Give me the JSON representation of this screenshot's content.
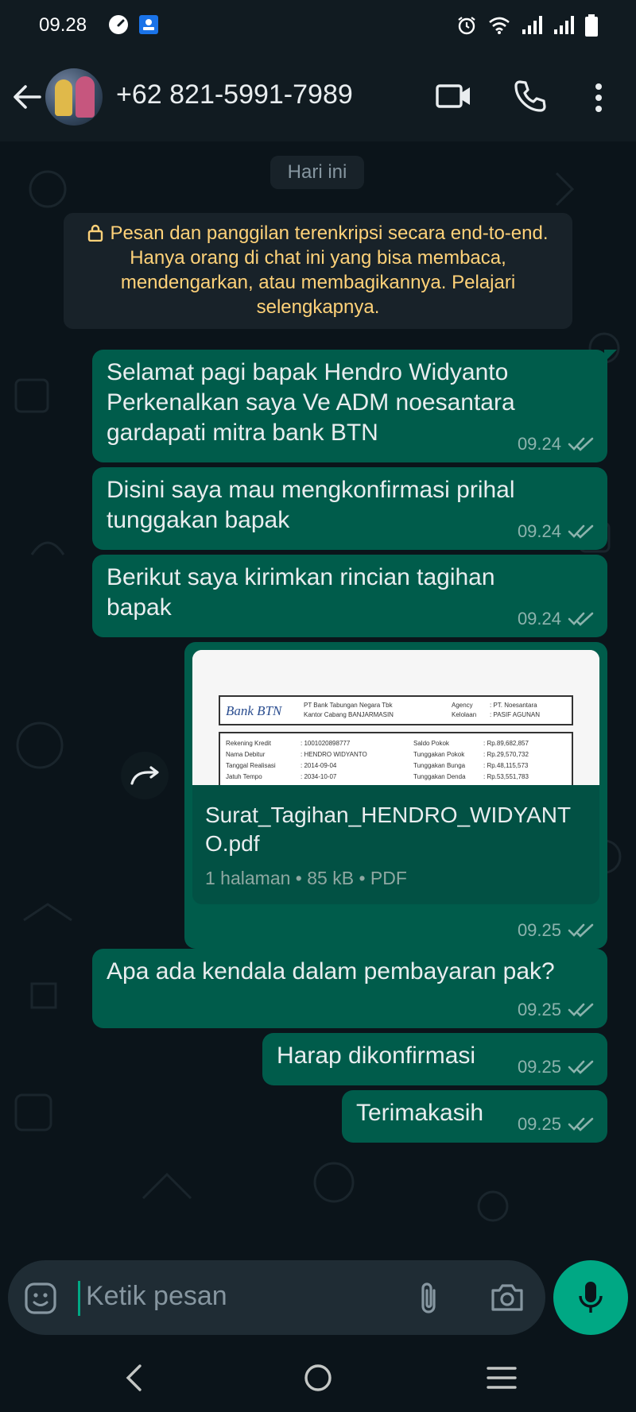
{
  "status_bar": {
    "time": "09.28",
    "left_icons": [
      "speedometer-icon",
      "app-badge-icon"
    ],
    "right_icons": [
      "alarm-icon",
      "wifi-icon",
      "signal-icon",
      "signal-icon",
      "battery-icon"
    ]
  },
  "header": {
    "contact": "+62 821-5991-7989",
    "icons": [
      "back-arrow-icon",
      "video-call-icon",
      "phone-call-icon",
      "more-vert-icon"
    ]
  },
  "chat": {
    "day_label": "Hari ini",
    "encryption_notice": "Pesan dan panggilan terenkripsi secara end-to-end. Hanya orang di chat ini yang bisa membaca, mendengarkan, atau membagikannya. Pelajari selengkapnya.",
    "messages": [
      {
        "text": "Selamat pagi bapak Hendro Widyanto\nPerkenalkan saya Ve ADM noesantara gardapati mitra bank BTN",
        "time": "09.24"
      },
      {
        "text": "Disini saya mau mengkonfirmasi prihal tunggakan bapak",
        "time": "09.24"
      },
      {
        "text": "Berikut saya kirimkan rincian tagihan bapak",
        "time": "09.24"
      },
      {
        "text": "Apa ada kendala dalam pembayaran pak?",
        "time": "09.25"
      },
      {
        "text": "Harap dikonfirmasi",
        "time": "09.25"
      },
      {
        "text": "Terimakasih",
        "time": "09.25"
      }
    ],
    "document": {
      "filename": "Surat_Tagihan_HENDRO_WIDYANTO.pdf",
      "info": "1 halaman • 85 kB • PDF",
      "time": "09.25",
      "preview": {
        "bank_logo": "Bank BTN",
        "bank_name_1": "PT Bank Tabungan Negara Tbk",
        "bank_name_2": "Kantor Cabang BANJARMASIN",
        "agency_label": "Agency",
        "agency_value": ": PT. Noesantara",
        "kelolaan_label": "Kelolaan",
        "kelolaan_value": ": PASIF AGUNAN",
        "rows": [
          {
            "l": "Rekening Kredit",
            "v": ": 1001020898777",
            "l2": "Saldo Pokok",
            "v2": ": Rp.89,682,857"
          },
          {
            "l": "Nama Debitur",
            "v": ": HENDRO WIDYANTO",
            "l2": "Tunggakan Pokok",
            "v2": ": Rp.29,570,732"
          },
          {
            "l": "Tanggal Realisasi",
            "v": ": 2014-09-04",
            "l2": "Tunggakan Bunga",
            "v2": ": Rp.48,115,573"
          },
          {
            "l": "Jatuh Tempo",
            "v": ": 2034-10-07",
            "l2": "Tunggakan Denda",
            "v2": ": Rp.53,551,783"
          }
        ]
      }
    }
  },
  "composer": {
    "placeholder": "Ketik pesan",
    "icons": [
      "sticker-icon",
      "attachment-icon",
      "camera-icon",
      "microphone-icon"
    ]
  },
  "colors": {
    "background": "#0b141a",
    "header": "#111b21",
    "outgoing_bubble": "#005c4b",
    "accent": "#00a884",
    "notice_text": "#ffd279"
  }
}
